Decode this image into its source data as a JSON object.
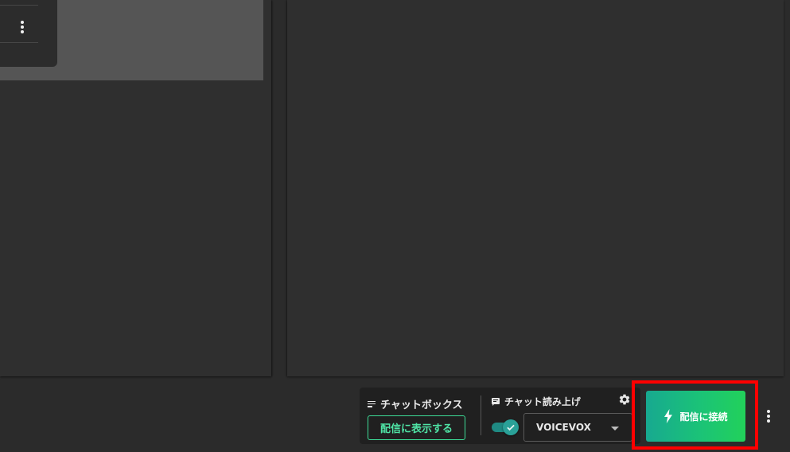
{
  "chatbox": {
    "label": "チャットボックス",
    "show_button": "配信に表示する"
  },
  "tts": {
    "label": "チャット読み上げ",
    "enabled": true,
    "selected_voice": "VOICEVOX"
  },
  "connect": {
    "label": "配信に接続"
  },
  "colors": {
    "accent_green": "#3ddc97",
    "toggle_teal": "#2aa198",
    "highlight": "#ff0000",
    "connect_gradient_start": "#17a990",
    "connect_gradient_end": "#22d15a"
  },
  "icons": {
    "chatbox": "lines-icon",
    "tts": "comment-icon",
    "settings": "gear-icon",
    "connect": "bolt-icon",
    "more": "more-vert-icon"
  }
}
